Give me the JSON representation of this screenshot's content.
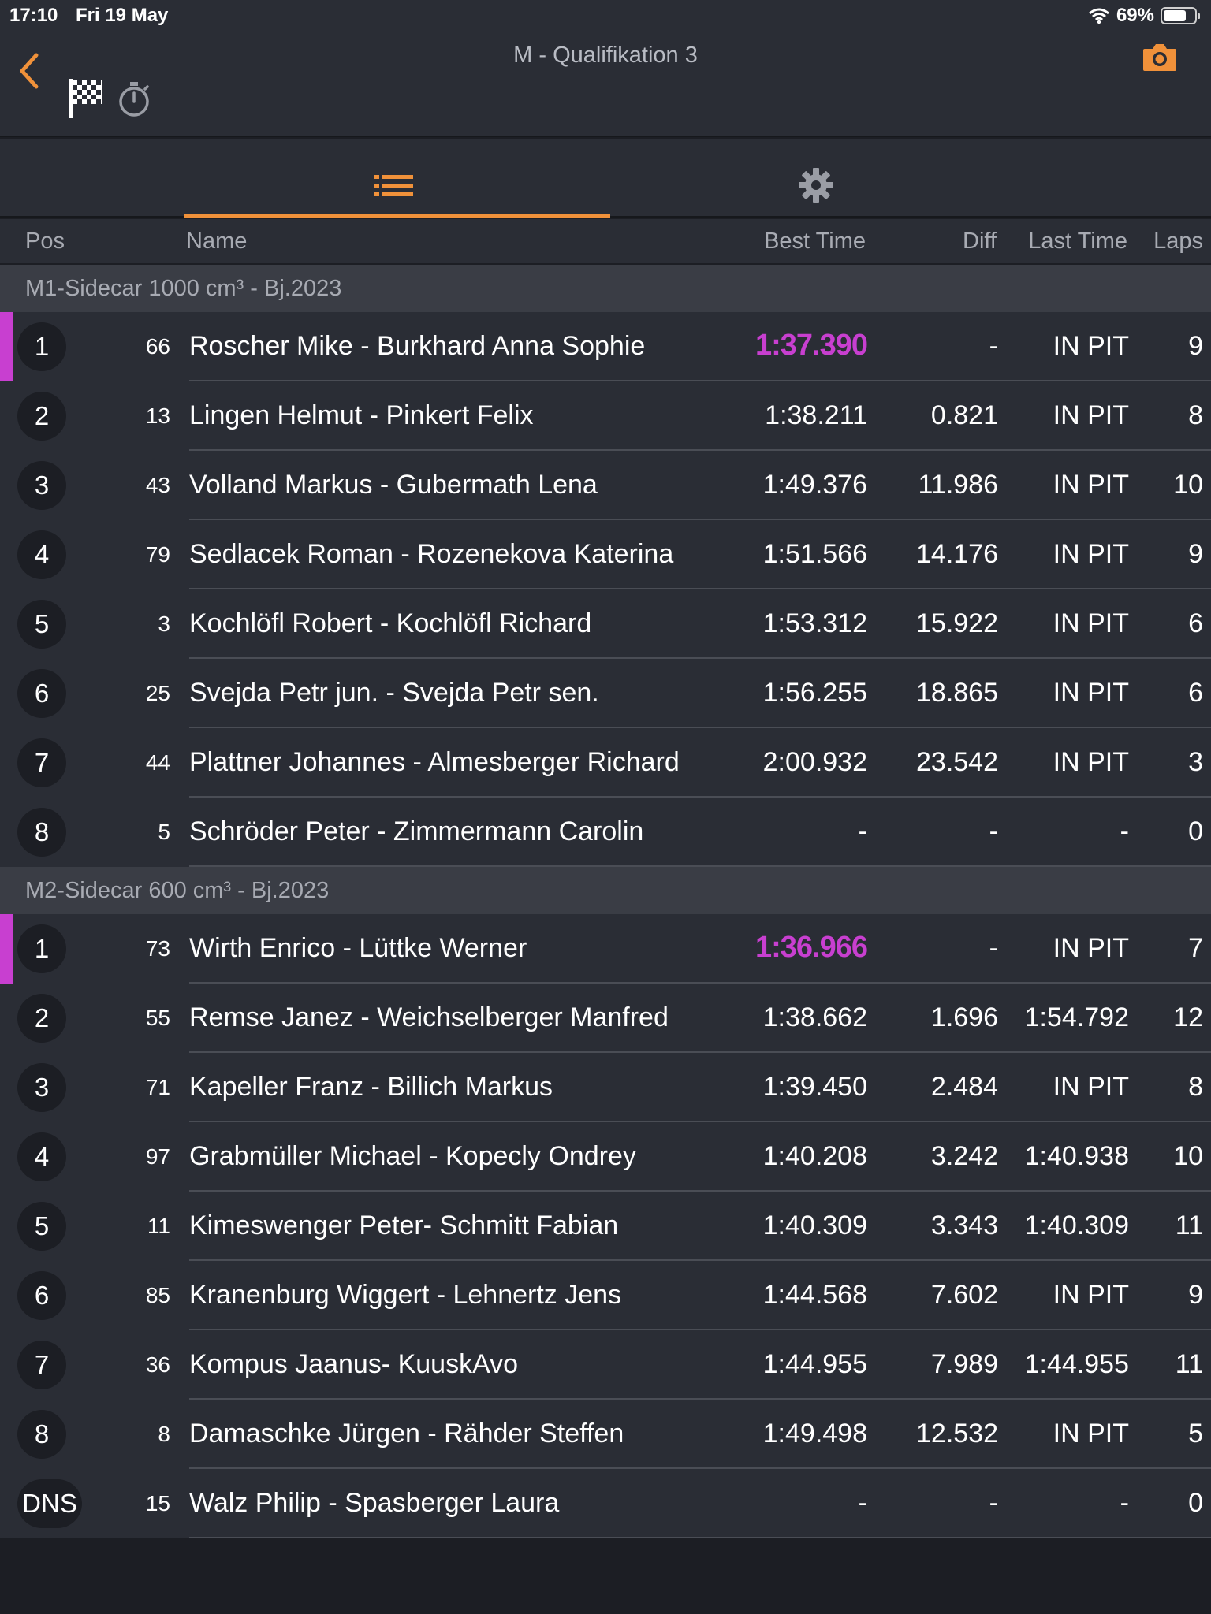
{
  "status": {
    "time": "17:10",
    "date": "Fri 19 May",
    "battery": "69%"
  },
  "header": {
    "title": "M - Qualifikation 3"
  },
  "columns": {
    "pos": "Pos",
    "name": "Name",
    "best": "Best Time",
    "diff": "Diff",
    "last": "Last Time",
    "laps": "Laps"
  },
  "accent_color": "#f0913a",
  "fastest_color": "#c83fd0",
  "groups": [
    {
      "title": "M1-Sidecar 1000 cm³ - Bj.2023",
      "rows": [
        {
          "pos": "1",
          "num": "66",
          "name": "Roscher Mike - Burkhard Anna Sophie",
          "best": "1:37.390",
          "diff": "-",
          "last": "IN PIT",
          "laps": "9",
          "fastest": true
        },
        {
          "pos": "2",
          "num": "13",
          "name": "Lingen  Helmut - Pinkert Felix",
          "best": "1:38.211",
          "diff": "0.821",
          "last": "IN PIT",
          "laps": "8"
        },
        {
          "pos": "3",
          "num": "43",
          "name": "Volland Markus - Gubermath Lena",
          "best": "1:49.376",
          "diff": "11.986",
          "last": "IN PIT",
          "laps": "10"
        },
        {
          "pos": "4",
          "num": "79",
          "name": "Sedlacek  Roman - Rozenekova  Katerina",
          "best": "1:51.566",
          "diff": "14.176",
          "last": "IN PIT",
          "laps": "9"
        },
        {
          "pos": "5",
          "num": "3",
          "name": "Kochlöfl  Robert - Kochlöfl Richard",
          "best": "1:53.312",
          "diff": "15.922",
          "last": "IN PIT",
          "laps": "6"
        },
        {
          "pos": "6",
          "num": "25",
          "name": "Svejda  Petr jun. - Svejda Petr sen.",
          "best": "1:56.255",
          "diff": "18.865",
          "last": "IN PIT",
          "laps": "6"
        },
        {
          "pos": "7",
          "num": "44",
          "name": "Plattner Johannes - Almesberger Richard",
          "best": "2:00.932",
          "diff": "23.542",
          "last": "IN PIT",
          "laps": "3"
        },
        {
          "pos": "8",
          "num": "5",
          "name": "Schröder  Peter - Zimmermann Carolin",
          "best": "-",
          "diff": "-",
          "last": "-",
          "laps": "0"
        }
      ]
    },
    {
      "title": "M2-Sidecar 600 cm³ - Bj.2023",
      "rows": [
        {
          "pos": "1",
          "num": "73",
          "name": "Wirth  Enrico - Lüttke Werner",
          "best": "1:36.966",
          "diff": "-",
          "last": "IN PIT",
          "laps": "7",
          "fastest": true
        },
        {
          "pos": "2",
          "num": "55",
          "name": "Remse  Janez - Weichselberger Manfred",
          "best": "1:38.662",
          "diff": "1.696",
          "last": "1:54.792",
          "laps": "12"
        },
        {
          "pos": "3",
          "num": "71",
          "name": "Kapeller  Franz - Billich Markus",
          "best": "1:39.450",
          "diff": "2.484",
          "last": "IN PIT",
          "laps": "8"
        },
        {
          "pos": "4",
          "num": "97",
          "name": "Grabmüller  Michael - Kopecly Ondrey",
          "best": "1:40.208",
          "diff": "3.242",
          "last": "1:40.938",
          "laps": "10"
        },
        {
          "pos": "5",
          "num": "11",
          "name": "Kimeswenger Peter- Schmitt Fabian",
          "best": "1:40.309",
          "diff": "3.343",
          "last": "1:40.309",
          "laps": "11"
        },
        {
          "pos": "6",
          "num": "85",
          "name": "Kranenburg Wiggert - Lehnertz Jens",
          "best": "1:44.568",
          "diff": "7.602",
          "last": "IN PIT",
          "laps": "9"
        },
        {
          "pos": "7",
          "num": "36",
          "name": "Kompus Jaanus- KuuskAvo",
          "best": "1:44.955",
          "diff": "7.989",
          "last": "1:44.955",
          "laps": "11"
        },
        {
          "pos": "8",
          "num": "8",
          "name": "Damaschke  Jürgen - Rähder Steffen",
          "best": "1:49.498",
          "diff": "12.532",
          "last": "IN PIT",
          "laps": "5"
        },
        {
          "pos": "DNS",
          "num": "15",
          "name": "Walz Philip - Spasberger Laura",
          "best": "-",
          "diff": "-",
          "last": "-",
          "laps": "0"
        }
      ]
    }
  ]
}
